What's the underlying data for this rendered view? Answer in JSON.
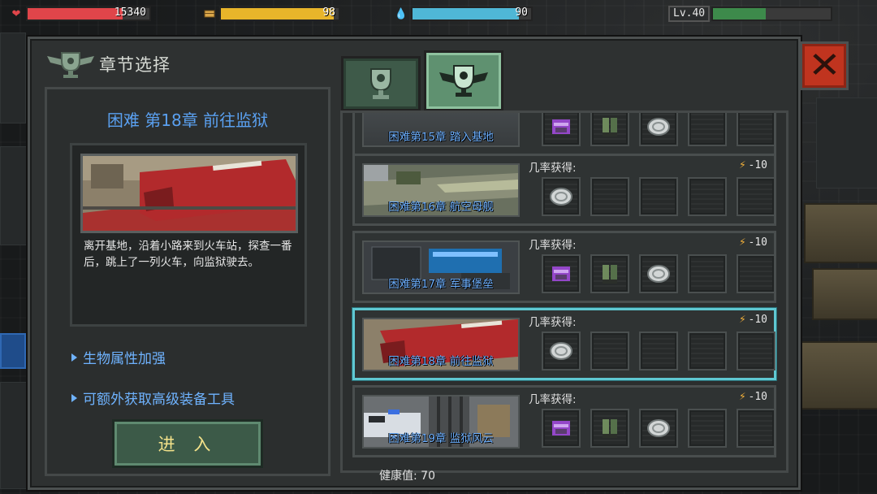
{
  "hud": {
    "health_value": "15340",
    "health_fraction": 0.78,
    "energy_value": "98",
    "energy_fraction": 0.96,
    "water_value": "90",
    "water_fraction": 0.9,
    "level_label": "Lv.40",
    "exp_fraction": 0.45,
    "icons": [
      "heart-icon",
      "food-icon",
      "water-drop-icon"
    ]
  },
  "dialog": {
    "title": "章节选择",
    "close_icon": "close-x-icon",
    "tabs": [
      {
        "icon": "trophy-icon",
        "active": false
      },
      {
        "icon": "winged-trophy-icon",
        "active": true
      }
    ],
    "selected": {
      "name": "困难 第18章 前往监狱",
      "description": "离开基地，沿着小路来到火车站，探查一番后，跳上了一列火车，向监狱驶去。",
      "perks": [
        "生物属性加强",
        "可额外获取高级装备工具"
      ],
      "enter_label": "进 入"
    },
    "chapters": [
      {
        "label": "困难第15章 踏入基地",
        "rate_label": "",
        "cost": "",
        "items": [
          "backpack-icon",
          "gear-icon",
          "coin-icon",
          "",
          ""
        ]
      },
      {
        "label": "困难第16章 航空母舰",
        "rate_label": "几率获得:",
        "cost": "-10",
        "items": [
          "coin-icon",
          "",
          "",
          "",
          ""
        ]
      },
      {
        "label": "困难第17章 军事堡垒",
        "rate_label": "几率获得:",
        "cost": "-10",
        "items": [
          "backpack-icon",
          "gear-icon",
          "coin-icon",
          "",
          ""
        ]
      },
      {
        "label": "困难第18章 前往监狱",
        "rate_label": "几率获得:",
        "cost": "-10",
        "items": [
          "coin-icon",
          "",
          "",
          "",
          ""
        ],
        "selected": true
      },
      {
        "label": "困难第19章 监狱风云",
        "rate_label": "几率获得:",
        "cost": "-10",
        "items": [
          "backpack-icon",
          "gear-icon",
          "coin-icon",
          "",
          ""
        ]
      }
    ],
    "health_label": "健康值: 70"
  },
  "colors": {
    "health_bar": "#e0454a",
    "energy_bar": "#e8b52a",
    "water_bar": "#4fb7d6",
    "exp_bar": "#3d8a4b",
    "chapter_blue": "#5aa0f0",
    "selected_border": "#5fc8d2",
    "enter_text": "#f3e28a"
  }
}
